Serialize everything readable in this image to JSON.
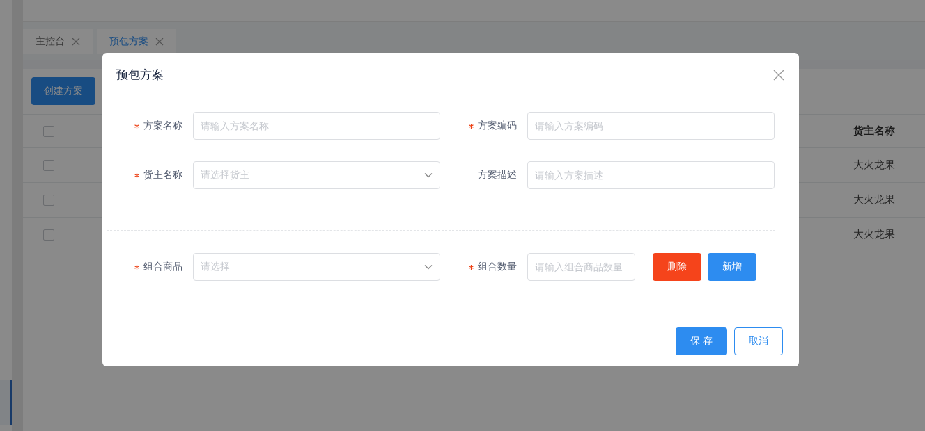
{
  "tabs": [
    {
      "label": "主控台",
      "selected": false
    },
    {
      "label": "预包方案",
      "selected": true
    }
  ],
  "toolbar": {
    "create_button": "创建方案"
  },
  "table": {
    "header_checkbox": {
      "checked": false
    },
    "owner_column": "货主名称",
    "rows": [
      {
        "checked": false,
        "owner": "大火龙果"
      },
      {
        "checked": false,
        "owner": "大火龙果"
      },
      {
        "checked": false,
        "owner": "大火龙果"
      }
    ]
  },
  "dialog": {
    "title": "预包方案",
    "fields": [
      {
        "label": "方案名称",
        "required": true,
        "kind": "input",
        "placeholder": "请输入方案名称"
      },
      {
        "label": "方案编码",
        "required": true,
        "kind": "input",
        "placeholder": "请输入方案编码"
      },
      {
        "label": "货主名称",
        "required": true,
        "kind": "select",
        "placeholder": "请选择货主"
      },
      {
        "label": "方案描述",
        "required": false,
        "kind": "input",
        "placeholder": "请输入方案描述"
      }
    ],
    "combo": {
      "product": {
        "label": "组合商品",
        "required": true,
        "kind": "select",
        "placeholder": "请选择"
      },
      "quantity": {
        "label": "组合数量",
        "required": true,
        "kind": "input",
        "placeholder": "请输入组合商品数量"
      },
      "delete_button": "删除",
      "add_button": "新增"
    },
    "save_button": "保 存",
    "cancel_button": "取消"
  }
}
